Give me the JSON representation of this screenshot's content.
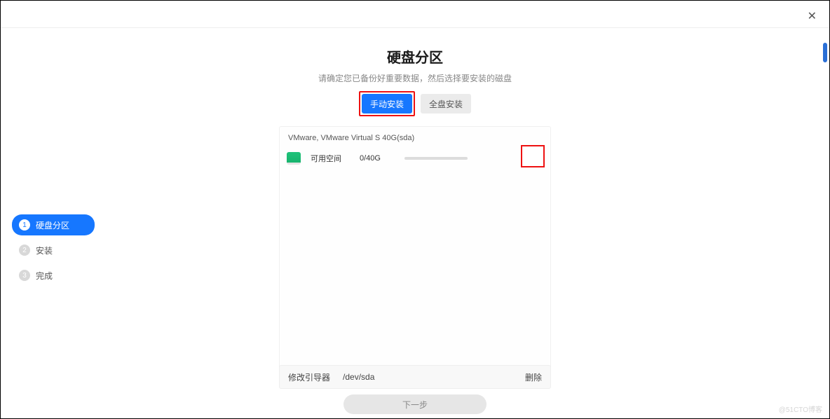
{
  "close_glyph": "✕",
  "sidebar": {
    "steps": [
      {
        "num": "1",
        "label": "硬盘分区",
        "active": true
      },
      {
        "num": "2",
        "label": "安装",
        "active": false
      },
      {
        "num": "3",
        "label": "完成",
        "active": false
      }
    ]
  },
  "page": {
    "title": "硬盘分区",
    "subtitle": "请确定您已备份好重要数据，然后选择要安装的磁盘"
  },
  "tabs": {
    "manual": "手动安装",
    "full": "全盘安装"
  },
  "disk": {
    "header": "VMware, VMware Virtual S 40G(sda)",
    "row": {
      "label": "可用空间",
      "size": "0/40G"
    }
  },
  "boot": {
    "label": "修改引导器",
    "value": "/dev/sda",
    "delete": "删除"
  },
  "next": "下一步",
  "watermark": "@51CTO博客"
}
